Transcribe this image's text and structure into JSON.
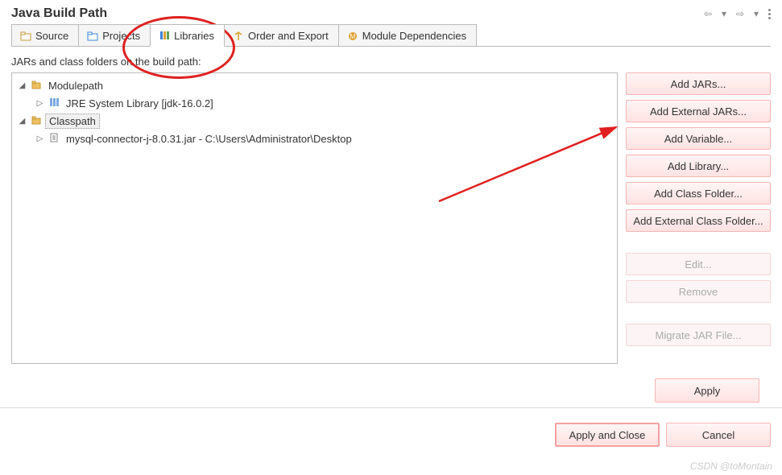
{
  "header": {
    "title": "Java Build Path"
  },
  "tabs": {
    "source": "Source",
    "projects": "Projects",
    "libraries": "Libraries",
    "order_export": "Order and Export",
    "module_deps": "Module Dependencies"
  },
  "description": "JARs and class folders on the build path:",
  "tree": {
    "modulepath": {
      "label": "Modulepath",
      "jre": "JRE System Library [jdk-16.0.2]"
    },
    "classpath": {
      "label": "Classpath",
      "jar": "mysql-connector-j-8.0.31.jar - C:\\Users\\Administrator\\Desktop"
    }
  },
  "buttons": {
    "add_jars": "Add JARs...",
    "add_ext_jars": "Add External JARs...",
    "add_variable": "Add Variable...",
    "add_library": "Add Library...",
    "add_class_folder": "Add Class Folder...",
    "add_ext_class_folder": "Add External Class Folder...",
    "edit": "Edit...",
    "remove": "Remove",
    "migrate": "Migrate JAR File..."
  },
  "footer": {
    "apply": "Apply",
    "apply_close": "Apply and Close",
    "cancel": "Cancel"
  },
  "watermark": "CSDN @toMontain"
}
